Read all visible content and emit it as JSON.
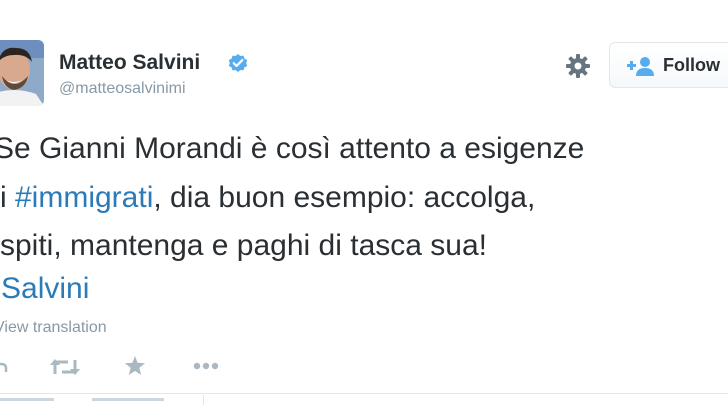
{
  "user": {
    "display_name": "Matteo Salvini",
    "handle": "@matteosalvinimi",
    "verified": true
  },
  "header_actions": {
    "settings_icon": "gear-icon",
    "follow_label": "Follow",
    "follow_icon": "add-user-icon"
  },
  "tweet": {
    "lines": [
      {
        "pre": "Se Gianni Morandi è così attento a esigenze",
        "tag": "",
        "post": ""
      },
      {
        "pre": "i ",
        "tag": "#immigrati",
        "post": ", dia buon esempio: accolga,"
      },
      {
        "pre": "spiti, mantenga e paghi di tasca sua!",
        "tag": "",
        "post": ""
      },
      {
        "pre": "",
        "tag": "Salvini",
        "post": ""
      }
    ],
    "translation_link": "View translation"
  },
  "action_icons": [
    "reply-icon",
    "retweet-icon",
    "favorite-icon",
    "more-icon"
  ],
  "colors": {
    "text": "#292f33",
    "link": "#2b7bb9",
    "muted": "#8899a6",
    "verified": "#55acee",
    "border": "#e1e8ed"
  }
}
